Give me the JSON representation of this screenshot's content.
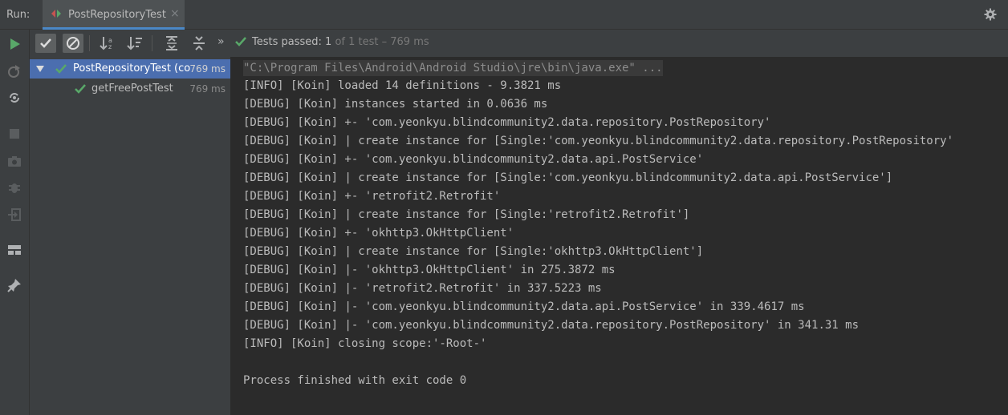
{
  "run_header": {
    "label": "Run:",
    "tab_title": "PostRepositoryTest",
    "close_glyph": "×",
    "settings_icon": "gear-icon"
  },
  "left_toolbar": {
    "icons": [
      "rerun-icon",
      "rerun-failed-icon",
      "toggle-auto-test-icon",
      "stop-icon",
      "screenshot-icon",
      "debug-icon",
      "exit-icon",
      "layout-icon",
      "pin-icon"
    ]
  },
  "test_toolbar": {
    "icons": [
      "show-passed-icon",
      "show-ignored-icon",
      "sort-alpha-icon",
      "sort-duration-icon",
      "expand-all-icon",
      "collapse-all-icon",
      "more-icon"
    ],
    "more_glyph": "»",
    "status_prefix": "Tests passed:",
    "passed_count": "1",
    "status_suffix": "of 1 test – 769 ms"
  },
  "tree": {
    "items": [
      {
        "name": "PostRepositoryTest (com",
        "duration": "769 ms",
        "selected": true
      },
      {
        "name": "getFreePostTest",
        "duration": "769 ms",
        "selected": false
      }
    ]
  },
  "console": {
    "lines": [
      "\"C:\\Program Files\\Android\\Android Studio\\jre\\bin\\java.exe\" ...",
      "[INFO] [Koin] loaded 14 definitions - 9.3821 ms",
      "[DEBUG] [Koin] instances started in 0.0636 ms",
      "[DEBUG] [Koin] +- 'com.yeonkyu.blindcommunity2.data.repository.PostRepository'",
      "[DEBUG] [Koin] | create instance for [Single:'com.yeonkyu.blindcommunity2.data.repository.PostRepository'",
      "[DEBUG] [Koin] +- 'com.yeonkyu.blindcommunity2.data.api.PostService'",
      "[DEBUG] [Koin] | create instance for [Single:'com.yeonkyu.blindcommunity2.data.api.PostService']",
      "[DEBUG] [Koin] +- 'retrofit2.Retrofit'",
      "[DEBUG] [Koin] | create instance for [Single:'retrofit2.Retrofit']",
      "[DEBUG] [Koin] +- 'okhttp3.OkHttpClient'",
      "[DEBUG] [Koin] | create instance for [Single:'okhttp3.OkHttpClient']",
      "[DEBUG] [Koin] |- 'okhttp3.OkHttpClient' in 275.3872 ms",
      "[DEBUG] [Koin] |- 'retrofit2.Retrofit' in 337.5223 ms",
      "[DEBUG] [Koin] |- 'com.yeonkyu.blindcommunity2.data.api.PostService' in 339.4617 ms",
      "[DEBUG] [Koin] |- 'com.yeonkyu.blindcommunity2.data.repository.PostRepository' in 341.31 ms",
      "[INFO] [Koin] closing scope:'-Root-'",
      "",
      "Process finished with exit code 0"
    ]
  },
  "colors": {
    "pass_green": "#59a869",
    "selection": "#4b6eaf",
    "panel": "#3c3f41",
    "console_bg": "#2b2b2b"
  }
}
